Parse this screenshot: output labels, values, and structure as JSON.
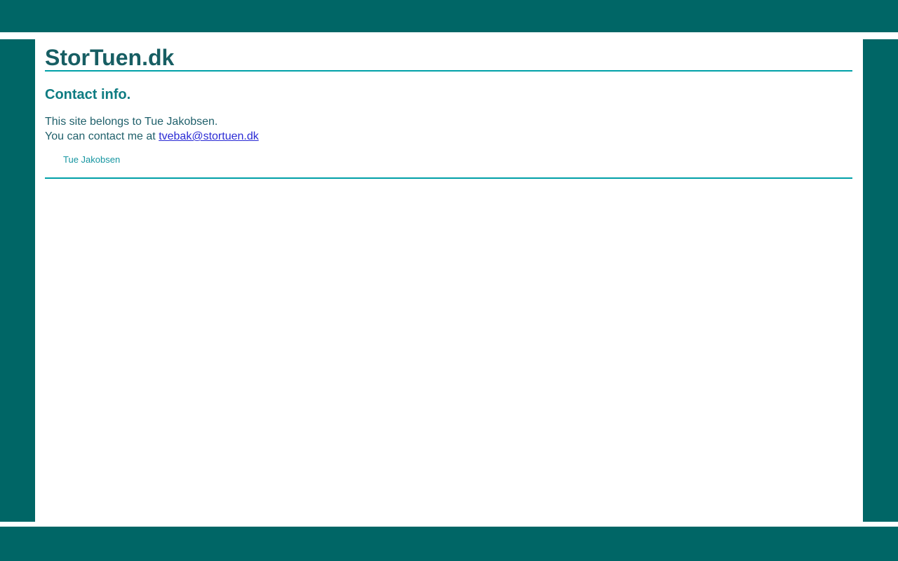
{
  "page": {
    "title": "StorTuen.dk"
  },
  "contact": {
    "heading": "Contact info.",
    "line1": "This site belongs to Tue Jakobsen.",
    "line2_prefix": "You can contact me at ",
    "email_link": "tvebak@stortuen.dk",
    "signature": "Tue Jakobsen"
  },
  "colors": {
    "frame_teal": "#006666",
    "rule_teal": "#00A0A8",
    "title_text": "#175E63",
    "heading_text": "#0E7C82",
    "body_text": "#20606B",
    "link_blue": "#2B2BD5",
    "signature_teal": "#1595A0",
    "background": "#ffffff"
  }
}
